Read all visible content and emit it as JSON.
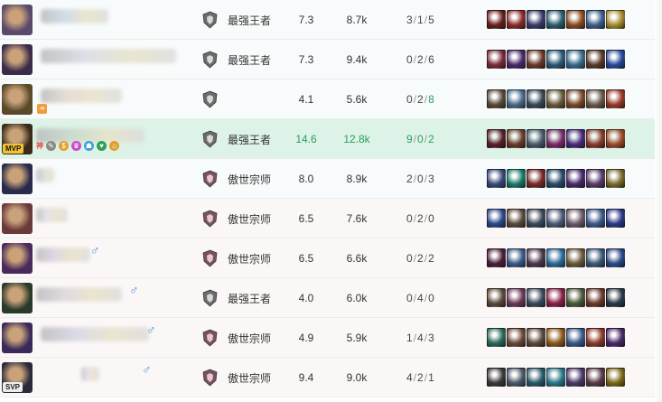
{
  "rows": [
    {
      "team": "blue",
      "mvp": false,
      "badge": "",
      "rank": "最强王者",
      "rank_tier": "king",
      "score": "7.3",
      "gold": "8.7k",
      "kda": [
        "3",
        "1",
        "5"
      ],
      "hl": false,
      "deaths_hl": false,
      "assist_hl": false,
      "champ_color": "#5a4a6a",
      "items": [
        "#6a1f1f",
        "#8c2a2a",
        "#3a3b6b",
        "#2d5b6e",
        "#8a4a1f",
        "#3d5e8a",
        "#a58a2d"
      ]
    },
    {
      "team": "blue",
      "mvp": false,
      "badge": "",
      "rank": "最强王者",
      "rank_tier": "king",
      "score": "7.3",
      "gold": "9.4k",
      "kda": [
        "0",
        "2",
        "6"
      ],
      "hl": false,
      "deaths_hl": false,
      "assist_hl": false,
      "champ_color": "#3b2c4a",
      "items": [
        "#7a2a3a",
        "#4a2a6a",
        "#6a3a2a",
        "#2a5a7a",
        "#3a6a8a",
        "#5a3a2a",
        "#2a4a9a"
      ]
    },
    {
      "team": "blue",
      "mvp": false,
      "badge": "",
      "rank": "",
      "rank_tier": "king",
      "score": "4.1",
      "gold": "5.6k",
      "kda": [
        "0",
        "2",
        "8"
      ],
      "hl": false,
      "deaths_hl": false,
      "assist_hl": true,
      "champ_color": "#5a4a2a",
      "items": [
        "#5a4a3a",
        "#4a6a8a",
        "#3a4a5a",
        "#6a5a3a",
        "#7a4a2a",
        "#6a5a4a",
        "#9a3a2a"
      ]
    },
    {
      "team": "blue",
      "mvp": true,
      "badge": "MVP",
      "rank": "最强王者",
      "rank_tier": "king",
      "score": "14.6",
      "gold": "12.8k",
      "kda": [
        "9",
        "0",
        "2"
      ],
      "hl": true,
      "deaths_hl": false,
      "assist_hl": false,
      "champ_color": "#3a2a1a",
      "items": [
        "#5a1f2a",
        "#6a3a2a",
        "#4a5a6a",
        "#7a2a6a",
        "#4a2a7a",
        "#8a3a2a",
        "#9a4a2a"
      ]
    },
    {
      "team": "blue",
      "mvp": false,
      "badge": "",
      "rank": "傲世宗师",
      "rank_tier": "master",
      "score": "8.0",
      "gold": "8.9k",
      "kda": [
        "2",
        "0",
        "3"
      ],
      "hl": false,
      "deaths_hl": false,
      "assist_hl": false,
      "champ_color": "#2a2a4a",
      "items": [
        "#3a4a7a",
        "#1a7a6a",
        "#7a2a2a",
        "#2a4a6a",
        "#4a2a6a",
        "#5a3a6a",
        "#7a6a2a"
      ]
    },
    {
      "team": "red",
      "mvp": false,
      "badge": "",
      "rank": "傲世宗师",
      "rank_tier": "master",
      "score": "6.5",
      "gold": "7.6k",
      "kda": [
        "0",
        "2",
        "0"
      ],
      "hl": false,
      "deaths_hl": false,
      "assist_hl": false,
      "champ_color": "#6a3a3a",
      "items": [
        "#2a4a8a",
        "#5a4a3a",
        "#3a4a5a",
        "#4a5a7a",
        "#6a5a6a",
        "#3a5a8a",
        "#2a3a8a"
      ]
    },
    {
      "team": "red",
      "mvp": false,
      "badge": "",
      "rank": "傲世宗师",
      "rank_tier": "master",
      "score": "6.5",
      "gold": "6.6k",
      "kda": [
        "0",
        "2",
        "2"
      ],
      "hl": false,
      "deaths_hl": false,
      "assist_hl": false,
      "champ_color": "#4a2a5a",
      "items": [
        "#4a1f3a",
        "#3a5a8a",
        "#4a3a4a",
        "#2a6a9a",
        "#6a5a3a",
        "#3a5a7a",
        "#2a4a8a"
      ]
    },
    {
      "team": "red",
      "mvp": false,
      "badge": "",
      "rank": "最强王者",
      "rank_tier": "king",
      "score": "4.0",
      "gold": "6.0k",
      "kda": [
        "0",
        "4",
        "0"
      ],
      "hl": false,
      "deaths_hl": false,
      "assist_hl": false,
      "champ_color": "#2a3a2a",
      "items": [
        "#5a4a3a",
        "#6a3a5a",
        "#3a4a5a",
        "#8a1f4a",
        "#4a5a3a",
        "#6a3a2a",
        "#2a3a4a"
      ]
    },
    {
      "team": "red",
      "mvp": false,
      "badge": "",
      "rank": "傲世宗师",
      "rank_tier": "master",
      "score": "4.9",
      "gold": "5.9k",
      "kda": [
        "1",
        "4",
        "3"
      ],
      "hl": false,
      "deaths_hl": false,
      "assist_hl": false,
      "champ_color": "#3a2a5a",
      "items": [
        "#2a6a5a",
        "#6a4a3a",
        "#5a4a3a",
        "#8a5a1a",
        "#3a5a8a",
        "#8a3a2a",
        "#4a2a6a"
      ]
    },
    {
      "team": "red",
      "mvp": false,
      "badge": "SVP",
      "rank": "傲世宗师",
      "rank_tier": "master",
      "score": "9.4",
      "gold": "9.0k",
      "kda": [
        "4",
        "2",
        "1"
      ],
      "hl": false,
      "deaths_hl": false,
      "assist_hl": false,
      "champ_color": "#2a2a3a",
      "items": [
        "#3a3a3a",
        "#4a5a6a",
        "#2a5a6a",
        "#2a7a8a",
        "#4a3a6a",
        "#5a3a4a",
        "#7a6a1a"
      ]
    }
  ],
  "mvp_tags": [
    "神",
    "✎",
    "$",
    "♛",
    "☗",
    "♥",
    "⌂"
  ],
  "gender_symbol": "♂",
  "tag_badge": "➔"
}
